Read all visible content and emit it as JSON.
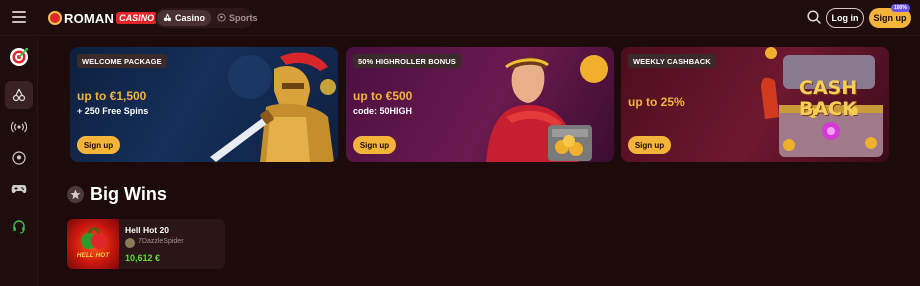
{
  "header": {
    "logo_main": "ROMAN",
    "logo_sub": "CASINO",
    "modes": [
      {
        "label": "Casino",
        "active": true
      },
      {
        "label": "Sports",
        "active": false
      }
    ],
    "login_label": "Log in",
    "signup_label": "Sign up",
    "signup_badge": "100%"
  },
  "sidebar": {
    "items": [
      {
        "icon": "target-dart-icon",
        "active": false
      },
      {
        "icon": "cherries-icon",
        "active": true
      },
      {
        "icon": "live-broadcast-icon",
        "active": false
      },
      {
        "icon": "soccer-ball-icon",
        "active": false
      },
      {
        "icon": "gamepad-icon",
        "active": false
      },
      {
        "icon": "headset-support-icon",
        "active": false
      }
    ]
  },
  "promos": [
    {
      "tag": "WELCOME PACKAGE",
      "headline": "up to €1,500",
      "sub": "+ 250 Free Spins",
      "button": "Sign up"
    },
    {
      "tag": "50% HIGHROLLER BONUS",
      "headline": "up to €500",
      "sub": "code: 50HIGH",
      "button": "Sign up"
    },
    {
      "tag": "WEEKLY CASHBACK",
      "headline": "up to 25%",
      "sub": "",
      "button": "Sign up",
      "art_text_1": "CASH",
      "art_text_2": "BACK"
    }
  ],
  "big_wins": {
    "title": "Big Wins",
    "items": [
      {
        "game": "Hell Hot 20",
        "user": "7DazzleSpider",
        "amount": "10,612 €",
        "thumb_text": "HELL HOT"
      }
    ]
  },
  "colors": {
    "accent": "#f4b43a",
    "background": "#1d0b0b",
    "win_green": "#5fdc3c",
    "brand_red": "#e0262a"
  }
}
